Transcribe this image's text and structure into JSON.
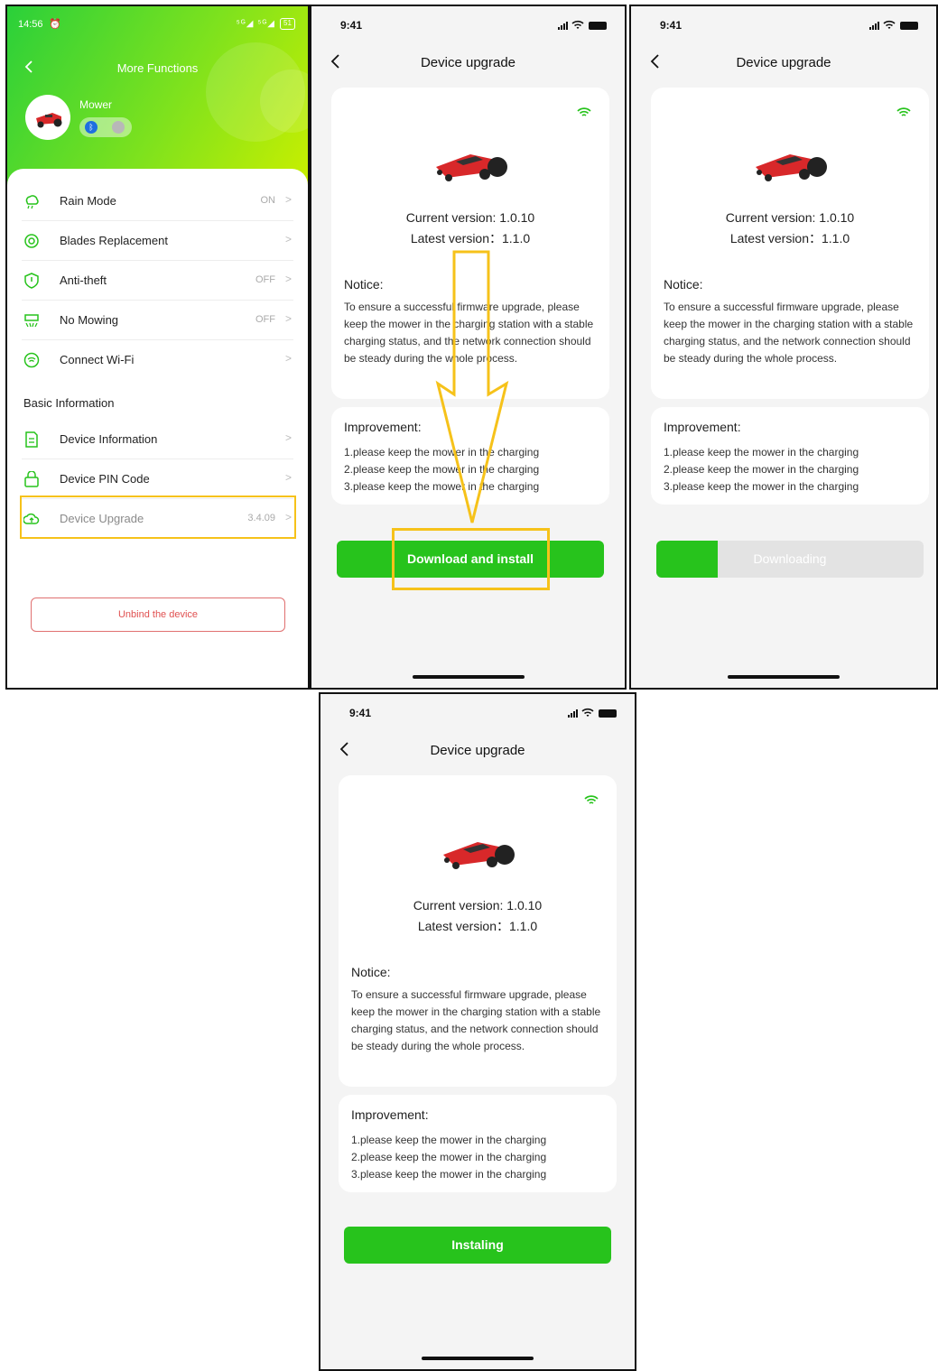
{
  "screen1": {
    "status_time": "14:56",
    "status_signal": "⁵ᴳ◢ ⁵ᴳ◢",
    "battery": "51",
    "title": "More Functions",
    "device_name": "Mower",
    "bt_glyph": "ᛒ",
    "rows": [
      {
        "label": "Rain Mode",
        "value": "ON",
        "icon": "rain-cloud-icon"
      },
      {
        "label": "Blades Replacement",
        "value": "",
        "icon": "blade-icon"
      },
      {
        "label": "Anti-theft",
        "value": "OFF",
        "icon": "shield-icon"
      },
      {
        "label": "No Mowing",
        "value": "OFF",
        "icon": "no-mowing-icon"
      },
      {
        "label": "Connect Wi-Fi",
        "value": "",
        "icon": "wifi-circle-icon"
      }
    ],
    "section_title": "Basic Information",
    "info_rows": [
      {
        "label": "Device Information",
        "value": "",
        "icon": "document-icon"
      },
      {
        "label": "Device PIN Code",
        "value": "",
        "icon": "lock-icon"
      },
      {
        "label": "Device Upgrade",
        "value": "3.4.09",
        "icon": "cloud-upload-icon"
      }
    ],
    "unbind_label": "Unbind the device",
    "chevron": ">"
  },
  "upgrade": {
    "status_time": "9:41",
    "title": "Device upgrade",
    "current_version": "Current version: 1.0.10",
    "latest_version": "Latest version：1.1.0",
    "notice_title": "Notice:",
    "notice_text": "To ensure a successful firmware upgrade, please keep the mower in the charging station with a stable charging status, and the network connection should be steady during the whole process.",
    "improvement_title": "Improvement:",
    "improvements": [
      "1.please keep the mower in the charging",
      "2.please keep the mower in the charging",
      "3.please keep the mower in the charging"
    ]
  },
  "buttons": {
    "download": "Download and install",
    "downloading": "Downloading",
    "downloading_progress": 0.23,
    "installing": "Instaling"
  },
  "colors": {
    "accent_green": "#27c31c",
    "highlight_yellow": "#f6c21a",
    "danger_red": "#e05050",
    "progress_track": "#e3e3e3"
  }
}
